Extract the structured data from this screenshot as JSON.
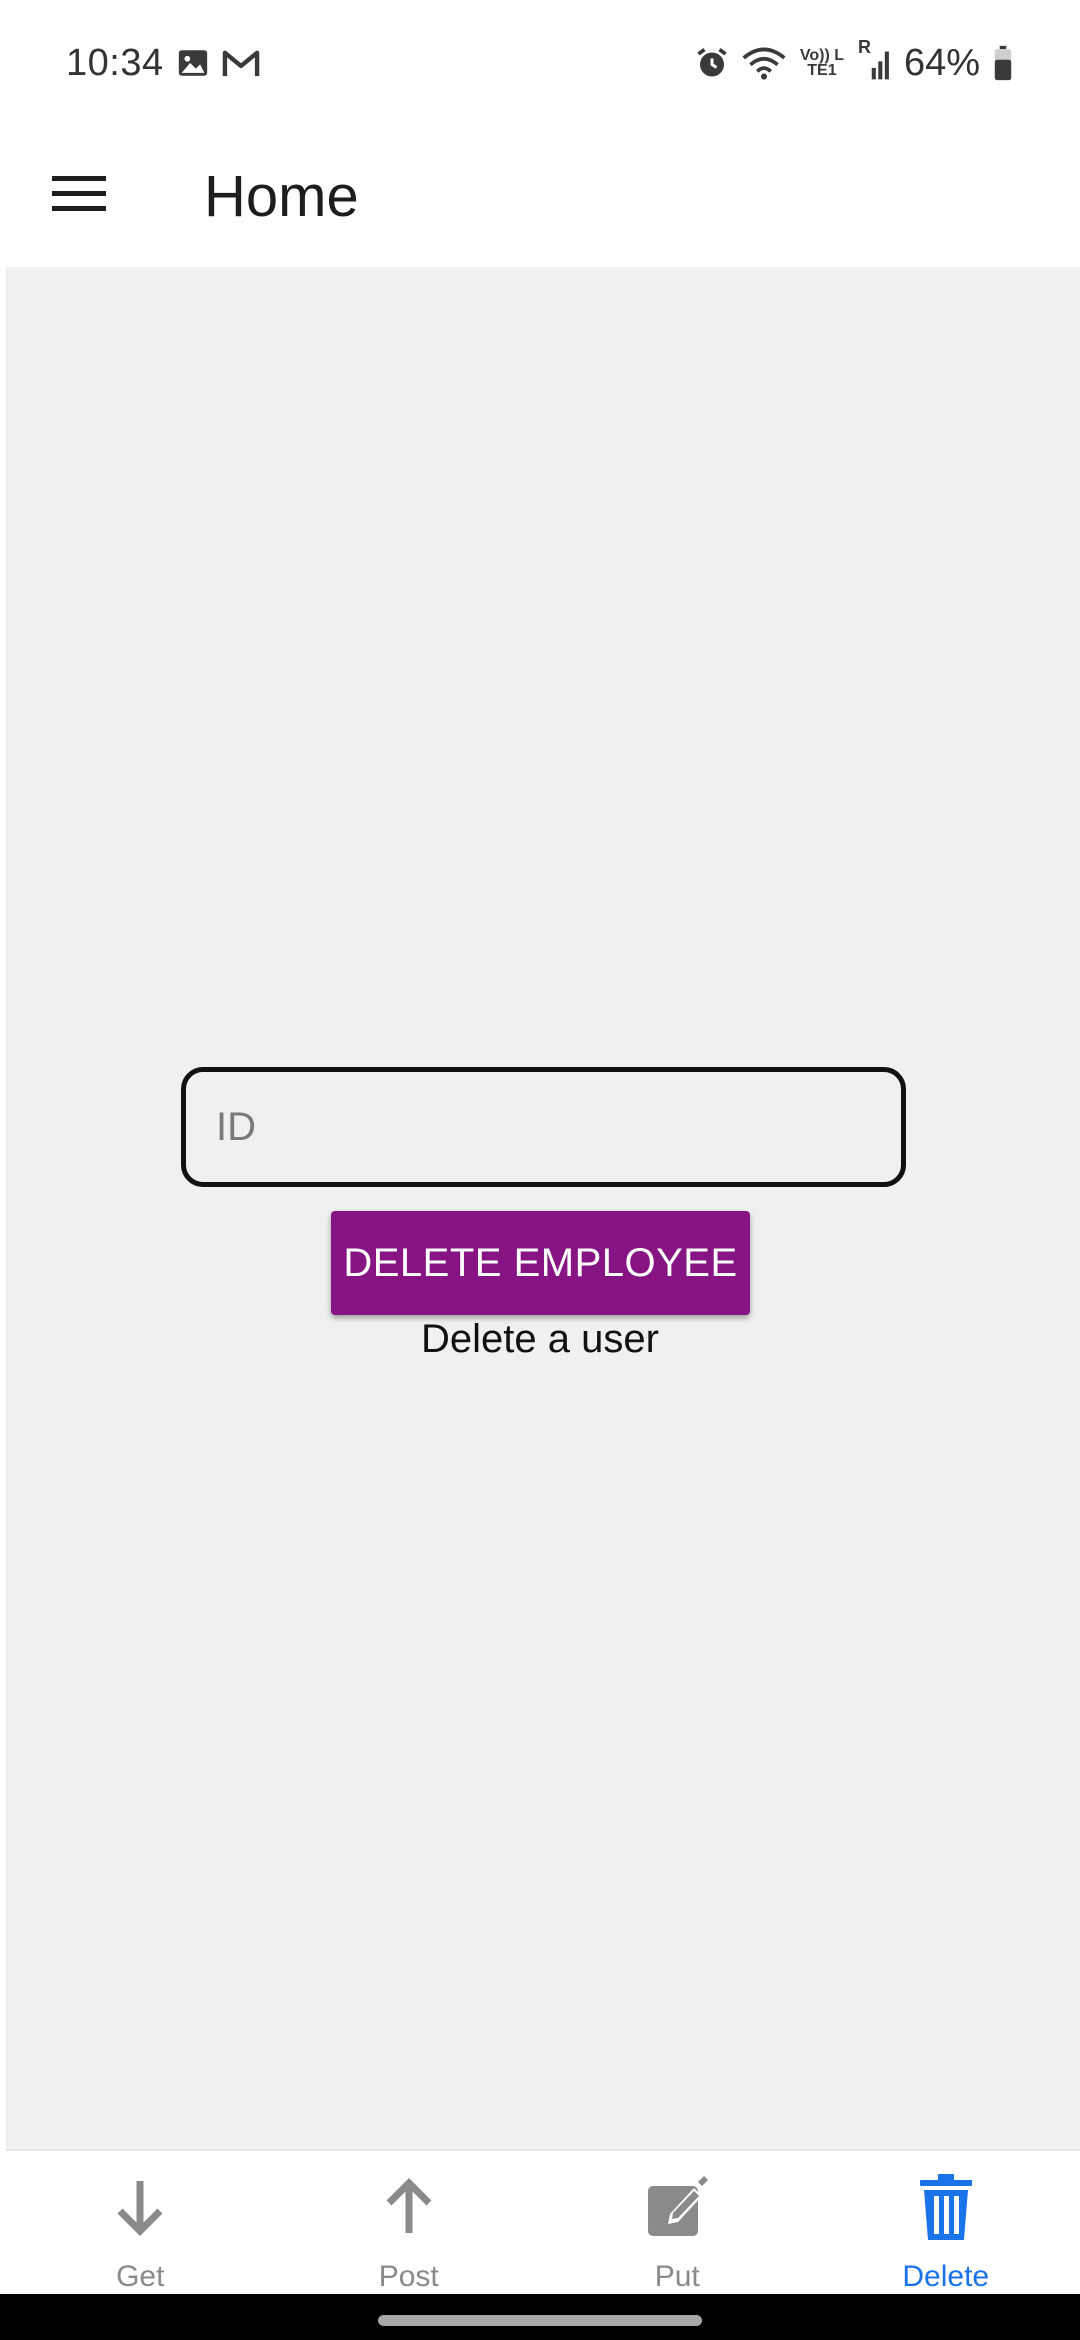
{
  "status_bar": {
    "time": "10:34",
    "battery": "64%",
    "network_label": "Vo)) LTE1",
    "roaming": "R",
    "icons": [
      "gallery-icon",
      "gmail-icon",
      "alarm-icon",
      "wifi-icon",
      "signal-icon",
      "battery-icon"
    ]
  },
  "app_bar": {
    "title": "Home",
    "menu_icon": "hamburger-menu-icon"
  },
  "form": {
    "id_placeholder": "ID",
    "id_value": "",
    "delete_button_label": "DELETE EMPLOYEE",
    "caption": "Delete a user"
  },
  "bottom_nav": {
    "items": [
      {
        "label": "Get",
        "icon": "arrow-down-icon",
        "active": false
      },
      {
        "label": "Post",
        "icon": "arrow-up-icon",
        "active": false
      },
      {
        "label": "Put",
        "icon": "edit-icon",
        "active": false
      },
      {
        "label": "Delete",
        "icon": "trash-icon",
        "active": true
      }
    ]
  },
  "colors": {
    "accent_purple": "#861583",
    "active_blue": "#1a73e8",
    "inactive_gray": "#8a8a8a",
    "content_bg": "#f0f0f0"
  }
}
